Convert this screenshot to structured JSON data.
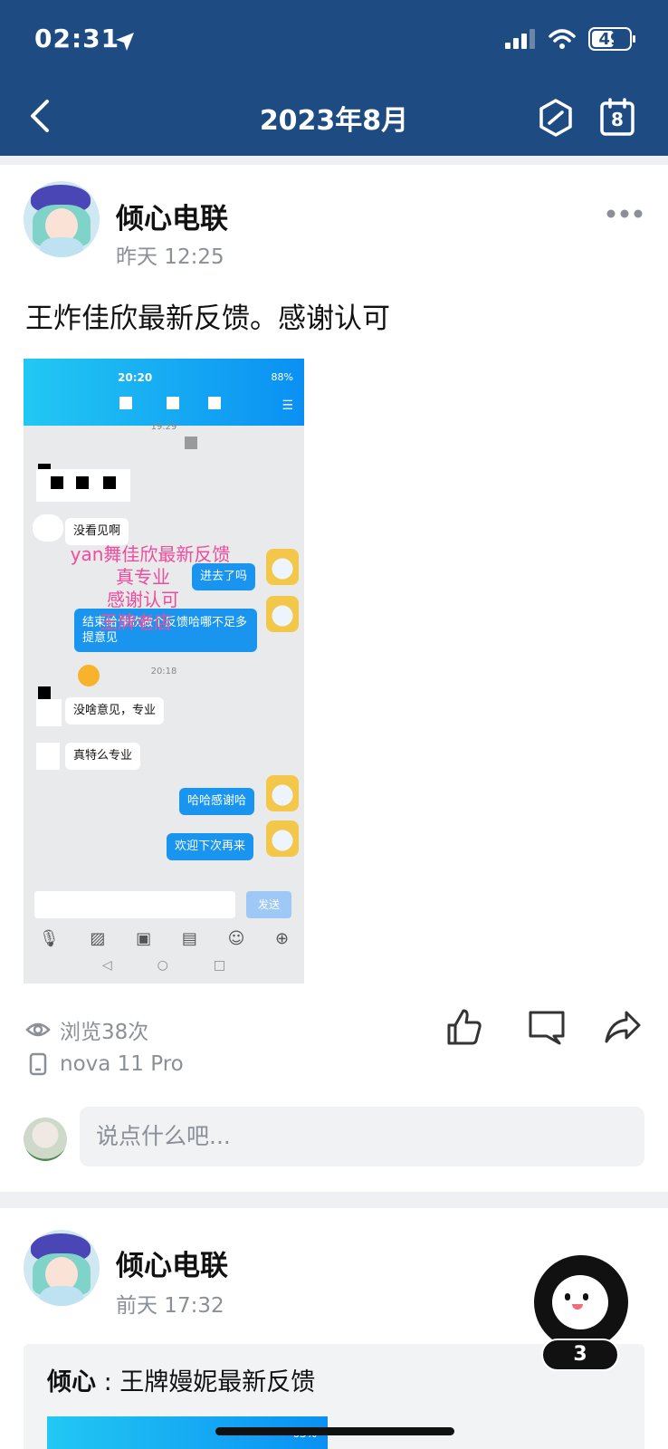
{
  "status_bar": {
    "time": "02:31",
    "battery": "49"
  },
  "header": {
    "title": "2023年8月",
    "calendar_day": "8"
  },
  "post": {
    "author": "倾心电联",
    "time": "昨天 12:25",
    "text": "王炸佳欣最新反馈。感谢认可",
    "screenshot": {
      "status_time": "20:20",
      "status_battery": "88%",
      "timestamps": [
        "19:29",
        "20:18"
      ],
      "messages": [
        {
          "side": "in",
          "text": "没看见啊"
        },
        {
          "side": "out",
          "text": "进去了吗"
        },
        {
          "side": "out",
          "text": "结束给佳欣做个反馈哈哪不足多提意见"
        },
        {
          "side": "in",
          "text": "没啥意见，专业"
        },
        {
          "side": "in",
          "text": "真特么专业"
        },
        {
          "side": "out",
          "text": "哈哈感谢哈"
        },
        {
          "side": "out",
          "text": "欢迎下次再来"
        }
      ],
      "watermark_lines": [
        "yan舞佳欣最新反馈",
        "真专业",
        "感谢认可",
        "王牌老店"
      ],
      "send_label": "发送"
    },
    "views": "浏览38次",
    "device": "nova 11 Pro",
    "comment_placeholder": "说点什么吧..."
  },
  "post2": {
    "author": "倾心电联",
    "time": "前天 17:32",
    "quote_author": "倾心",
    "quote_sep": " : ",
    "quote_text": "王牌嫚妮最新反馈",
    "quote_img_text": "63%"
  },
  "floating_badge": "3",
  "colors": {
    "header_bg": "#1e4c82",
    "bubble_out": "#1995f0",
    "watermark": "#ef4c9c"
  }
}
